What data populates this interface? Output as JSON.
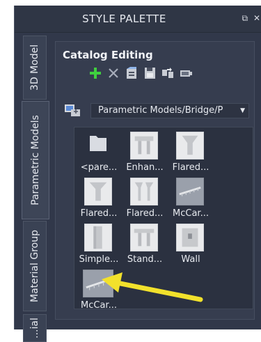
{
  "window": {
    "title": "STYLE PALETTE",
    "btn_restore": "⧉",
    "btn_close": "✕"
  },
  "tabs": [
    {
      "label": "3D Model"
    },
    {
      "label": "Parametric Models"
    },
    {
      "label": "Material Group"
    },
    {
      "label": "...ial"
    }
  ],
  "catalog": {
    "title": "Catalog Editing",
    "toolbar": [
      {
        "icon": "plus-icon",
        "color": "#3fcf3f"
      },
      {
        "icon": "close-icon",
        "color": "#a7adba"
      },
      {
        "icon": "import-icon",
        "color": "#c8ccd4"
      },
      {
        "icon": "save-icon",
        "color": "#c8ccd4"
      },
      {
        "icon": "convert-icon",
        "color": "#c8ccd4"
      },
      {
        "icon": "preview-icon",
        "color": "#c8ccd4"
      }
    ]
  },
  "path": {
    "value": "Parametric Models/Bridge/P"
  },
  "items": [
    {
      "label": "<pare...",
      "icon": "folder-icon"
    },
    {
      "label": "Enhan...",
      "icon": "pier-icon"
    },
    {
      "label": "Flared...",
      "icon": "pier-icon"
    },
    {
      "label": "Flared...",
      "icon": "pier-icon"
    },
    {
      "label": "Flared...",
      "icon": "pier-icon"
    },
    {
      "label": "McCar...",
      "icon": "beam-icon"
    },
    {
      "label": "Simple...",
      "icon": "column-icon"
    },
    {
      "label": "Stand...",
      "icon": "pier-icon"
    },
    {
      "label": "Wall",
      "icon": "wall-icon"
    },
    {
      "label": "McCar...",
      "icon": "beam-icon"
    }
  ],
  "annotation": {
    "arrow_color": "#f2e12c"
  }
}
